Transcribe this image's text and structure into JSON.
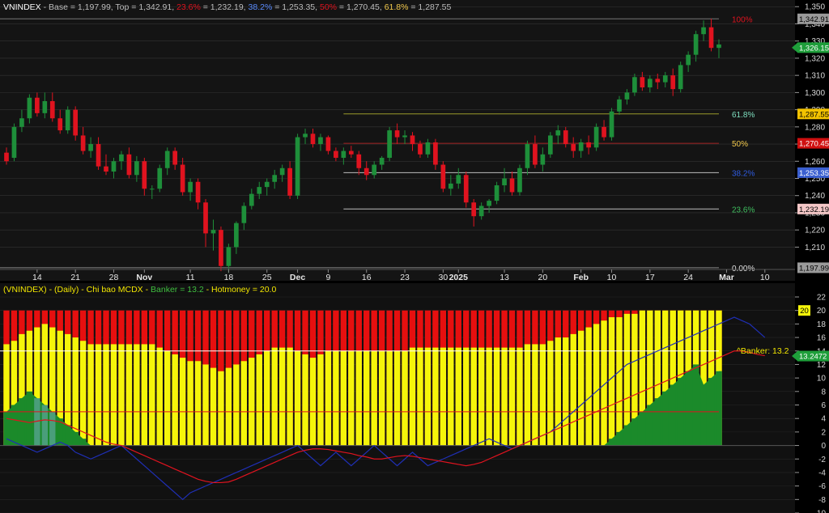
{
  "colors": {
    "background": "#0b0b0b",
    "upper_panel_bg": "#141414",
    "lower_panel_bg": "#111111",
    "grid": "#333333",
    "up_candle": "#1e8f3a",
    "down_candle": "#e0131f",
    "banker_bar": "#1b8a2a",
    "banker_peak": "#4a9e7a",
    "hotmoney_bar": "#f5f50a",
    "top_fill": "#e60f0f",
    "sma_red": "#e0131f",
    "blue_line": "#1f2fb5",
    "text_grey": "#bdbdbd"
  },
  "upper": {
    "title_parts": [
      {
        "text": "VNINDEX",
        "color": "#ffffff"
      },
      {
        "text": " - Base = 1,197.99, Top = 1,342.91, ",
        "color": "#bdbdbd"
      },
      {
        "text": "23.6%",
        "color": "#e0131f"
      },
      {
        "text": " = 1,232.19, ",
        "color": "#bdbdbd"
      },
      {
        "text": "38.2%",
        "color": "#5a8cff"
      },
      {
        "text": " = 1,253.35, ",
        "color": "#bdbdbd"
      },
      {
        "text": "50%",
        "color": "#e0131f"
      },
      {
        "text": " = 1,270.45, ",
        "color": "#bdbdbd"
      },
      {
        "text": "61.8%",
        "color": "#f2c94c"
      },
      {
        "text": " = 1,287.55",
        "color": "#bdbdbd"
      }
    ],
    "y_axis_ticks": [
      1210,
      1220,
      1230,
      1240,
      1250,
      1260,
      1270,
      1280,
      1290,
      1300,
      1310,
      1320,
      1330,
      1340,
      1350
    ],
    "x_ticks": [
      {
        "label": "14",
        "idx": 4,
        "bold": false
      },
      {
        "label": "21",
        "idx": 9,
        "bold": false
      },
      {
        "label": "28",
        "idx": 14,
        "bold": false
      },
      {
        "label": "Nov",
        "idx": 18,
        "bold": true
      },
      {
        "label": "11",
        "idx": 24,
        "bold": false
      },
      {
        "label": "18",
        "idx": 29,
        "bold": false
      },
      {
        "label": "25",
        "idx": 34,
        "bold": false
      },
      {
        "label": "Dec",
        "idx": 38,
        "bold": true
      },
      {
        "label": "9",
        "idx": 42,
        "bold": false
      },
      {
        "label": "16",
        "idx": 47,
        "bold": false
      },
      {
        "label": "23",
        "idx": 52,
        "bold": false
      },
      {
        "label": "30",
        "idx": 57,
        "bold": false
      },
      {
        "label": "2025",
        "idx": 59,
        "bold": true
      },
      {
        "label": "13",
        "idx": 65,
        "bold": false
      },
      {
        "label": "20",
        "idx": 70,
        "bold": false
      },
      {
        "label": "Feb",
        "idx": 75,
        "bold": true
      },
      {
        "label": "10",
        "idx": 79,
        "bold": false
      },
      {
        "label": "17",
        "idx": 84,
        "bold": false
      },
      {
        "label": "24",
        "idx": 89,
        "bold": false
      },
      {
        "label": "Mar",
        "idx": 94,
        "bold": true
      },
      {
        "label": "10",
        "idx": 99,
        "bold": false
      }
    ],
    "fib_levels": [
      {
        "label": "100%",
        "price": 1342.91,
        "color": "#e0131f",
        "line": "#777777"
      },
      {
        "label": "61.8%",
        "price": 1287.55,
        "color": "#7fe0c0",
        "line": "#9a9a2a"
      },
      {
        "label": "50%",
        "price": 1270.45,
        "color": "#f2c94c",
        "line": "#a02020"
      },
      {
        "label": "38.2%",
        "price": 1253.35,
        "color": "#2f5be0",
        "line": "#bdbdbd"
      },
      {
        "label": "23.6%",
        "price": 1232.19,
        "color": "#3fbf5f",
        "line": "#bdbdbd"
      },
      {
        "label": "0.00%",
        "price": 1197.99,
        "color": "#e0e0e0",
        "line": "#888888"
      }
    ],
    "price_tags": [
      {
        "text": "1,342.91",
        "price": 1342.91,
        "bg": "#9a9a9a",
        "fg": "#000000"
      },
      {
        "text": "1,326.15",
        "price": 1326.15,
        "bg": "#1e9e3a",
        "fg": "#ffffff",
        "arrow": true
      },
      {
        "text": "1,287.55",
        "price": 1287.55,
        "bg": "#f2c200",
        "fg": "#000000"
      },
      {
        "text": "1,270.45",
        "price": 1270.45,
        "bg": "#d01010",
        "fg": "#ffffff"
      },
      {
        "text": "1,253.35",
        "price": 1253.35,
        "bg": "#3a5fd0",
        "fg": "#ffffff"
      },
      {
        "text": "1,232.19",
        "price": 1232.19,
        "bg": "#f4c7c7",
        "fg": "#000000"
      },
      {
        "text": "1,197.99",
        "price": 1197.99,
        "bg": "#9a9a9a",
        "fg": "#000000"
      }
    ]
  },
  "lower": {
    "title_parts": [
      {
        "text": "(VNINDEX) - (Daily) - Chi bao MCDX - ",
        "color": "#f2e600"
      },
      {
        "text": "Banker = 13.2",
        "color": "#3fbf3f"
      },
      {
        "text": " - ",
        "color": "#f2e600"
      },
      {
        "text": "Hotmoney = 20.0",
        "color": "#f2e600"
      }
    ],
    "y_axis_ticks": [
      -10,
      -8,
      -6,
      -4,
      -2,
      0,
      2,
      4,
      6,
      8,
      10,
      12,
      14,
      16,
      18,
      20,
      22
    ],
    "banker_label": "^Banker: 13.2",
    "tags": [
      {
        "text": "20",
        "value": 20,
        "bg": "#f5f50a",
        "fg": "#000000"
      },
      {
        "text": "13.2472",
        "value": 13.2472,
        "bg": "#1e9e3a",
        "fg": "#ffffff",
        "arrow": true
      }
    ]
  },
  "chart_data": [
    {
      "type": "candlestick",
      "title": "VNINDEX - Base = 1,197.99, Top = 1,342.91",
      "ylim": [
        1197,
        1352
      ],
      "ohlc": [
        [
          1265,
          1268,
          1258,
          1260
        ],
        [
          1262,
          1282,
          1260,
          1280
        ],
        [
          1280,
          1290,
          1277,
          1285
        ],
        [
          1285,
          1299,
          1282,
          1297
        ],
        [
          1297,
          1300,
          1286,
          1288
        ],
        [
          1288,
          1300,
          1285,
          1295
        ],
        [
          1295,
          1300,
          1283,
          1285
        ],
        [
          1285,
          1290,
          1276,
          1278
        ],
        [
          1278,
          1292,
          1276,
          1290
        ],
        [
          1290,
          1292,
          1272,
          1275
        ],
        [
          1275,
          1280,
          1264,
          1266
        ],
        [
          1266,
          1274,
          1262,
          1270
        ],
        [
          1270,
          1274,
          1255,
          1257
        ],
        [
          1257,
          1264,
          1252,
          1254
        ],
        [
          1254,
          1262,
          1250,
          1260
        ],
        [
          1260,
          1266,
          1255,
          1264
        ],
        [
          1264,
          1268,
          1250,
          1252
        ],
        [
          1252,
          1263,
          1248,
          1260
        ],
        [
          1260,
          1262,
          1240,
          1244
        ],
        [
          1244,
          1246,
          1238,
          1244
        ],
        [
          1244,
          1258,
          1242,
          1256
        ],
        [
          1256,
          1268,
          1252,
          1266
        ],
        [
          1266,
          1268,
          1255,
          1258
        ],
        [
          1258,
          1262,
          1240,
          1242
        ],
        [
          1242,
          1250,
          1237,
          1248
        ],
        [
          1248,
          1250,
          1232,
          1236
        ],
        [
          1236,
          1238,
          1210,
          1218
        ],
        [
          1218,
          1226,
          1208,
          1220
        ],
        [
          1220,
          1222,
          1196,
          1199
        ],
        [
          1199,
          1212,
          1195,
          1210
        ],
        [
          1210,
          1225,
          1206,
          1224
        ],
        [
          1224,
          1236,
          1220,
          1234
        ],
        [
          1234,
          1244,
          1232,
          1241
        ],
        [
          1241,
          1248,
          1238,
          1245
        ],
        [
          1245,
          1250,
          1240,
          1248
        ],
        [
          1248,
          1255,
          1244,
          1252
        ],
        [
          1252,
          1258,
          1248,
          1256
        ],
        [
          1256,
          1260,
          1238,
          1240
        ],
        [
          1240,
          1276,
          1238,
          1274
        ],
        [
          1274,
          1279,
          1270,
          1276
        ],
        [
          1276,
          1279,
          1268,
          1270
        ],
        [
          1270,
          1276,
          1266,
          1274
        ],
        [
          1274,
          1275,
          1264,
          1266
        ],
        [
          1266,
          1268,
          1260,
          1262
        ],
        [
          1262,
          1268,
          1258,
          1266
        ],
        [
          1266,
          1269,
          1262,
          1264
        ],
        [
          1264,
          1266,
          1252,
          1256
        ],
        [
          1256,
          1260,
          1249,
          1252
        ],
        [
          1252,
          1260,
          1250,
          1258
        ],
        [
          1258,
          1263,
          1255,
          1262
        ],
        [
          1262,
          1280,
          1260,
          1278
        ],
        [
          1278,
          1282,
          1270,
          1274
        ],
        [
          1274,
          1278,
          1270,
          1275
        ],
        [
          1275,
          1277,
          1266,
          1270
        ],
        [
          1270,
          1272,
          1262,
          1264
        ],
        [
          1264,
          1273,
          1262,
          1271
        ],
        [
          1271,
          1273,
          1255,
          1258
        ],
        [
          1258,
          1260,
          1242,
          1244
        ],
        [
          1244,
          1252,
          1240,
          1247
        ],
        [
          1247,
          1256,
          1244,
          1252
        ],
        [
          1252,
          1254,
          1233,
          1236
        ],
        [
          1236,
          1238,
          1222,
          1228
        ],
        [
          1228,
          1236,
          1226,
          1234
        ],
        [
          1234,
          1238,
          1230,
          1237
        ],
        [
          1237,
          1248,
          1235,
          1246
        ],
        [
          1246,
          1256,
          1242,
          1250
        ],
        [
          1250,
          1254,
          1240,
          1242
        ],
        [
          1242,
          1258,
          1240,
          1256
        ],
        [
          1256,
          1272,
          1252,
          1270
        ],
        [
          1270,
          1275,
          1256,
          1258
        ],
        [
          1258,
          1268,
          1254,
          1264
        ],
        [
          1264,
          1277,
          1262,
          1275
        ],
        [
          1275,
          1281,
          1270,
          1278
        ],
        [
          1278,
          1280,
          1268,
          1270
        ],
        [
          1270,
          1274,
          1262,
          1266
        ],
        [
          1266,
          1273,
          1262,
          1271
        ],
        [
          1271,
          1275,
          1264,
          1268
        ],
        [
          1268,
          1282,
          1266,
          1280
        ],
        [
          1280,
          1284,
          1272,
          1274
        ],
        [
          1274,
          1291,
          1272,
          1289
        ],
        [
          1289,
          1298,
          1287,
          1296
        ],
        [
          1296,
          1302,
          1293,
          1300
        ],
        [
          1300,
          1311,
          1298,
          1309
        ],
        [
          1309,
          1312,
          1301,
          1303
        ],
        [
          1303,
          1310,
          1300,
          1308
        ],
        [
          1308,
          1311,
          1302,
          1306
        ],
        [
          1306,
          1312,
          1303,
          1310
        ],
        [
          1310,
          1314,
          1298,
          1302
        ],
        [
          1302,
          1318,
          1300,
          1316
        ],
        [
          1316,
          1324,
          1312,
          1322
        ],
        [
          1322,
          1336,
          1318,
          1334
        ],
        [
          1334,
          1342,
          1330,
          1338
        ],
        [
          1338,
          1343,
          1324,
          1326
        ],
        [
          1326,
          1331,
          1320,
          1328
        ]
      ]
    },
    {
      "type": "bar",
      "title": "Chi bao MCDX",
      "ylim": [
        -10,
        22
      ],
      "series_names": [
        "Banker",
        "Hotmoney"
      ],
      "top_value": 20,
      "banker": [
        5,
        6,
        7,
        8,
        7,
        6,
        5,
        4,
        3,
        2,
        1,
        0,
        0,
        0,
        0,
        0,
        0,
        0,
        0,
        0,
        0,
        0,
        0,
        0,
        0,
        0,
        0,
        0,
        0,
        0,
        0,
        0,
        0,
        0,
        0,
        0,
        0,
        0,
        0,
        0,
        0,
        0,
        0,
        0,
        0,
        0,
        0,
        0,
        0,
        0,
        0,
        0,
        0,
        0,
        0,
        0,
        0,
        0,
        0,
        0,
        0,
        0,
        0,
        0,
        0,
        0,
        0,
        0,
        0,
        0,
        0,
        0,
        0,
        0,
        0,
        0,
        0,
        0,
        0,
        1,
        2,
        3,
        4,
        5,
        6,
        7,
        8,
        9,
        10,
        11,
        12,
        9,
        10,
        11,
        12,
        13,
        14,
        15,
        16,
        13.2,
        13.2,
        13.2
      ],
      "banker_peaks": [
        4,
        5,
        6
      ],
      "hotmoney": [
        15,
        15.5,
        16.5,
        17,
        17.5,
        18,
        17.5,
        17,
        16.5,
        16,
        15.5,
        15,
        15,
        15,
        15,
        15,
        15,
        15,
        15,
        15,
        14.5,
        14,
        13.5,
        13,
        12.5,
        12.5,
        12,
        11.5,
        11,
        11.5,
        12,
        12.5,
        13,
        13.5,
        14,
        14.5,
        14.5,
        14.5,
        14,
        13.5,
        13,
        13.5,
        14,
        14,
        14,
        14,
        14,
        14,
        14,
        14,
        14,
        14,
        14,
        14.5,
        14.5,
        14.5,
        14.5,
        14.5,
        14.5,
        14.5,
        14.5,
        14.5,
        14.5,
        14.5,
        14.5,
        14.5,
        14.5,
        14.5,
        15,
        15,
        15,
        15.5,
        16,
        16,
        16.5,
        17,
        17.5,
        18,
        18.5,
        19,
        19,
        19.5,
        19.5,
        20,
        20,
        20,
        20,
        20,
        20,
        20,
        20,
        20,
        20,
        20,
        20,
        20,
        20,
        20,
        20,
        20
      ],
      "red_line": [
        4,
        3.8,
        3.6,
        3.4,
        3.6,
        3.8,
        3.7,
        3.5,
        3,
        2.5,
        2,
        1.5,
        1,
        0.5,
        0.2,
        0,
        -0.5,
        -1,
        -1.5,
        -2,
        -2.5,
        -3,
        -3.5,
        -4,
        -4.5,
        -5,
        -5.3,
        -5.5,
        -5.5,
        -5.4,
        -5,
        -4.5,
        -4,
        -3.5,
        -3,
        -2.5,
        -2,
        -1.5,
        -1,
        -0.7,
        -0.5,
        -0.5,
        -0.6,
        -0.8,
        -1,
        -1.2,
        -1.5,
        -1.7,
        -2,
        -2,
        -1.8,
        -1.6,
        -1.5,
        -1.6,
        -1.8,
        -2,
        -2.2,
        -2.4,
        -2.6,
        -2.8,
        -3,
        -2.8,
        -2.5,
        -2,
        -1.5,
        -1,
        -0.5,
        0,
        0.5,
        1,
        1.5,
        2,
        2.5,
        3,
        3.5,
        4,
        4.5,
        5,
        5.5,
        6,
        6.5,
        7,
        7.5,
        8,
        8.5,
        9,
        9.5,
        10,
        10.5,
        11,
        11.5,
        12,
        12.5,
        13,
        13.5,
        14,
        14,
        13.8,
        13.5,
        13.3
      ],
      "blue_line": [
        1,
        0.5,
        0,
        -0.5,
        -1,
        -0.5,
        0,
        0.5,
        0,
        -1,
        -1.5,
        -2,
        -1.5,
        -1,
        -0.5,
        0,
        -1,
        -2,
        -3,
        -4,
        -5,
        -6,
        -7,
        -8,
        -7,
        -6.5,
        -6,
        -5.5,
        -5,
        -4.5,
        -4,
        -3.5,
        -3,
        -2.5,
        -2,
        -1.5,
        -1,
        -0.5,
        0,
        -1,
        -2,
        -3,
        -2,
        -1,
        -2,
        -3,
        -2,
        -1,
        0,
        -1,
        -2,
        -3,
        -2,
        -1,
        -2,
        -3,
        -2.5,
        -2,
        -1.5,
        -1,
        -0.5,
        0,
        0.5,
        1,
        0.5,
        0,
        -0.5,
        0,
        0.5,
        1,
        1.5,
        2,
        3,
        4,
        5,
        6,
        7,
        8,
        9,
        10,
        11,
        12,
        12.5,
        13,
        13.5,
        14,
        14.5,
        15,
        15.5,
        16,
        16.5,
        17,
        17.5,
        18,
        18.5,
        19,
        18.5,
        18,
        17,
        16
      ],
      "threshold_lines": [
        5,
        14
      ]
    }
  ]
}
